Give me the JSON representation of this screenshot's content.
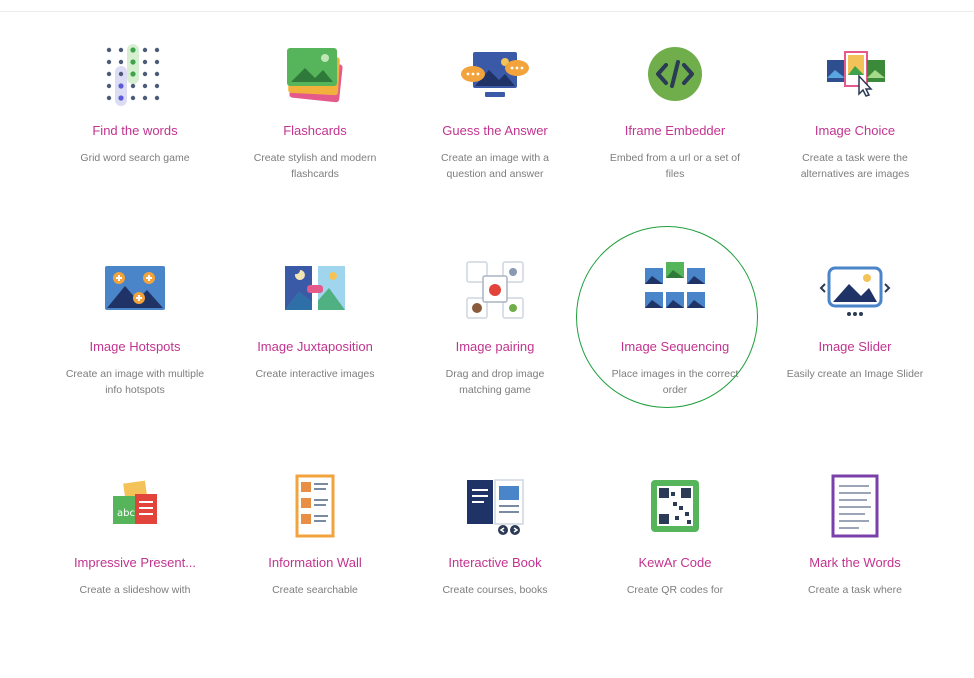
{
  "colors": {
    "title": "#c2348f",
    "desc": "#7d7d7d",
    "highlight": "#1e9e3a"
  },
  "cards": [
    {
      "title": "Find the words",
      "desc": "Grid word search game",
      "icon": "word-search-grid-icon"
    },
    {
      "title": "Flashcards",
      "desc": "Create stylish and modern flashcards",
      "icon": "flashcards-icon"
    },
    {
      "title": "Guess the Answer",
      "desc": "Create an image with a question and answer",
      "icon": "guess-answer-icon"
    },
    {
      "title": "Iframe Embedder",
      "desc": "Embed from a url or a set of files",
      "icon": "code-brackets-icon"
    },
    {
      "title": "Image Choice",
      "desc": "Create a task were the alternatives are images",
      "icon": "image-choice-icon"
    },
    {
      "title": "Image Hotspots",
      "desc": "Create an image with multiple info hotspots",
      "icon": "image-hotspots-icon"
    },
    {
      "title": "Image Juxtaposition",
      "desc": "Create interactive images",
      "icon": "image-juxtaposition-icon"
    },
    {
      "title": "Image pairing",
      "desc": "Drag and drop image matching game",
      "icon": "image-pairing-icon"
    },
    {
      "title": "Image Sequencing",
      "desc": "Place images in the correct order",
      "icon": "image-sequencing-icon"
    },
    {
      "title": "Image Slider",
      "desc": "Easily create an Image Slider",
      "icon": "image-slider-icon"
    },
    {
      "title": "Impressive Present...",
      "desc": "Create a slideshow with",
      "icon": "presentation-icon"
    },
    {
      "title": "Information Wall",
      "desc": "Create searchable",
      "icon": "information-wall-icon"
    },
    {
      "title": "Interactive Book",
      "desc": "Create courses, books",
      "icon": "interactive-book-icon"
    },
    {
      "title": "KewAr Code",
      "desc": "Create QR codes for",
      "icon": "qr-code-icon"
    },
    {
      "title": "Mark the Words",
      "desc": "Create a task where",
      "icon": "mark-words-document-icon"
    }
  ]
}
